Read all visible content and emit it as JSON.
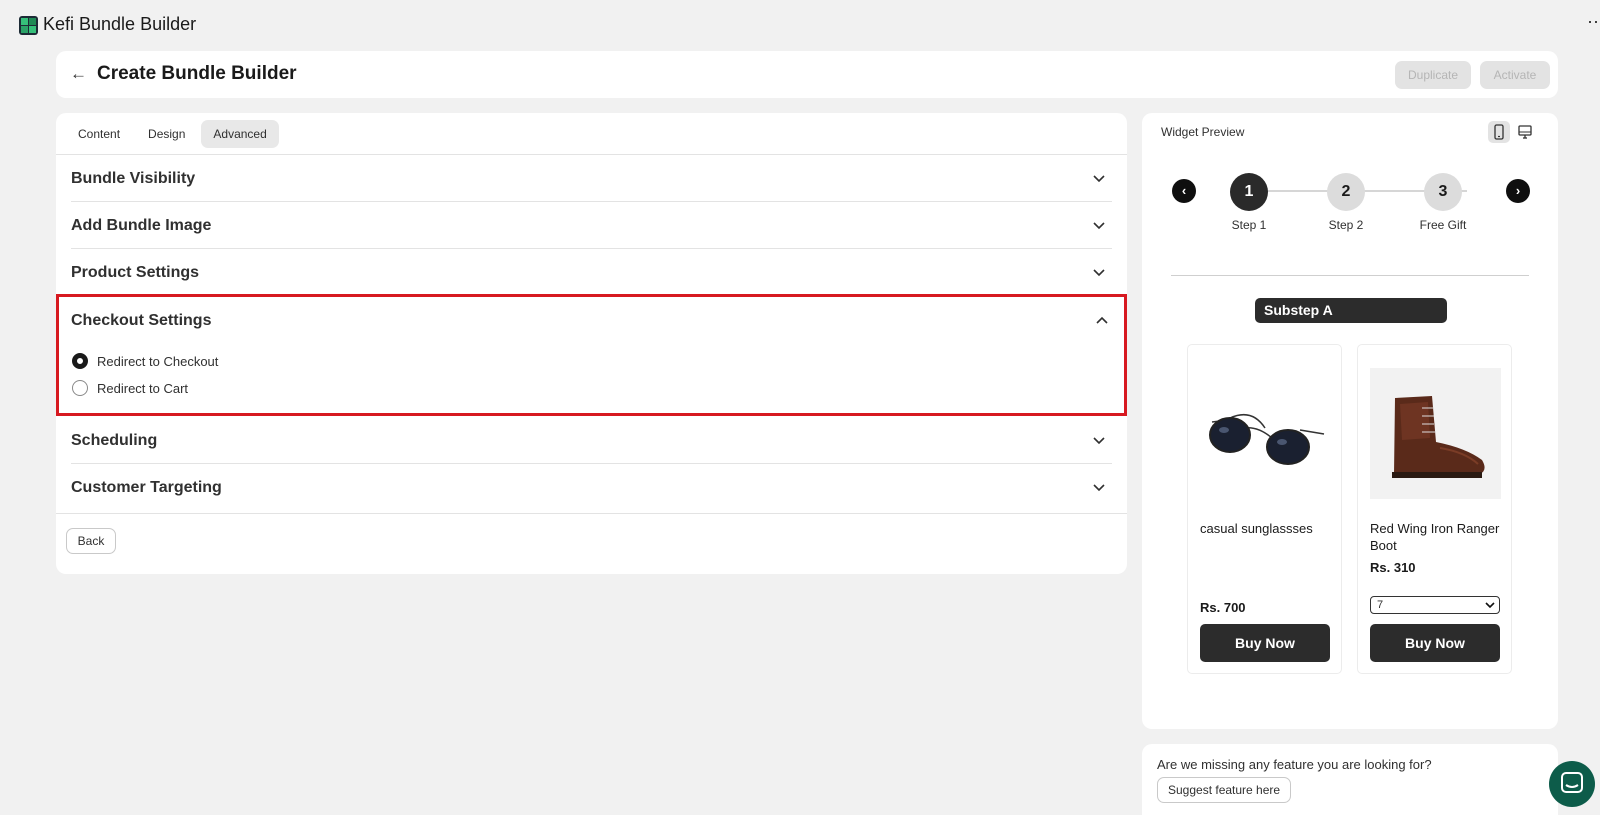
{
  "app": {
    "title": "Kefi Bundle Builder",
    "more_label": "⋯",
    "brand_colors": {
      "green": "#1f8a55",
      "dark": "#1d2b36"
    }
  },
  "header": {
    "back_icon": "←",
    "title": "Create Bundle Builder",
    "duplicate_label": "Duplicate",
    "activate_label": "Activate"
  },
  "tabs": [
    {
      "label": "Content",
      "active": false
    },
    {
      "label": "Design",
      "active": false
    },
    {
      "label": "Advanced",
      "active": true
    }
  ],
  "sections": {
    "bundle_visibility": "Bundle Visibility",
    "add_bundle_image": "Add Bundle Image",
    "product_settings": "Product Settings",
    "checkout_settings": "Checkout Settings",
    "scheduling": "Scheduling",
    "customer_targeting": "Customer Targeting"
  },
  "checkout": {
    "options": [
      {
        "label": "Redirect to Checkout",
        "selected": true
      },
      {
        "label": "Redirect to Cart",
        "selected": false
      }
    ],
    "highlight_color": "#d71920"
  },
  "back_label": "Back",
  "preview": {
    "title": "Widget Preview",
    "prev_icon": "‹",
    "next_icon": "›",
    "steps": [
      {
        "number": "1",
        "label": "Step 1",
        "active": true
      },
      {
        "number": "2",
        "label": "Step 2",
        "active": false
      },
      {
        "number": "3",
        "label": "Free Gift",
        "active": false
      }
    ],
    "substep": "Substep A",
    "products": [
      {
        "name": "casual sunglassses",
        "price": "Rs. 700",
        "button": "Buy Now",
        "image_icon": "sunglasses-image"
      },
      {
        "name": "Red Wing Iron Ranger Boot",
        "price": "Rs. 310",
        "quantity": "7",
        "button": "Buy Now",
        "image_icon": "boot-image"
      }
    ]
  },
  "feedback": {
    "question": "Are we missing any feature you are looking for?",
    "button": "Suggest feature here"
  }
}
